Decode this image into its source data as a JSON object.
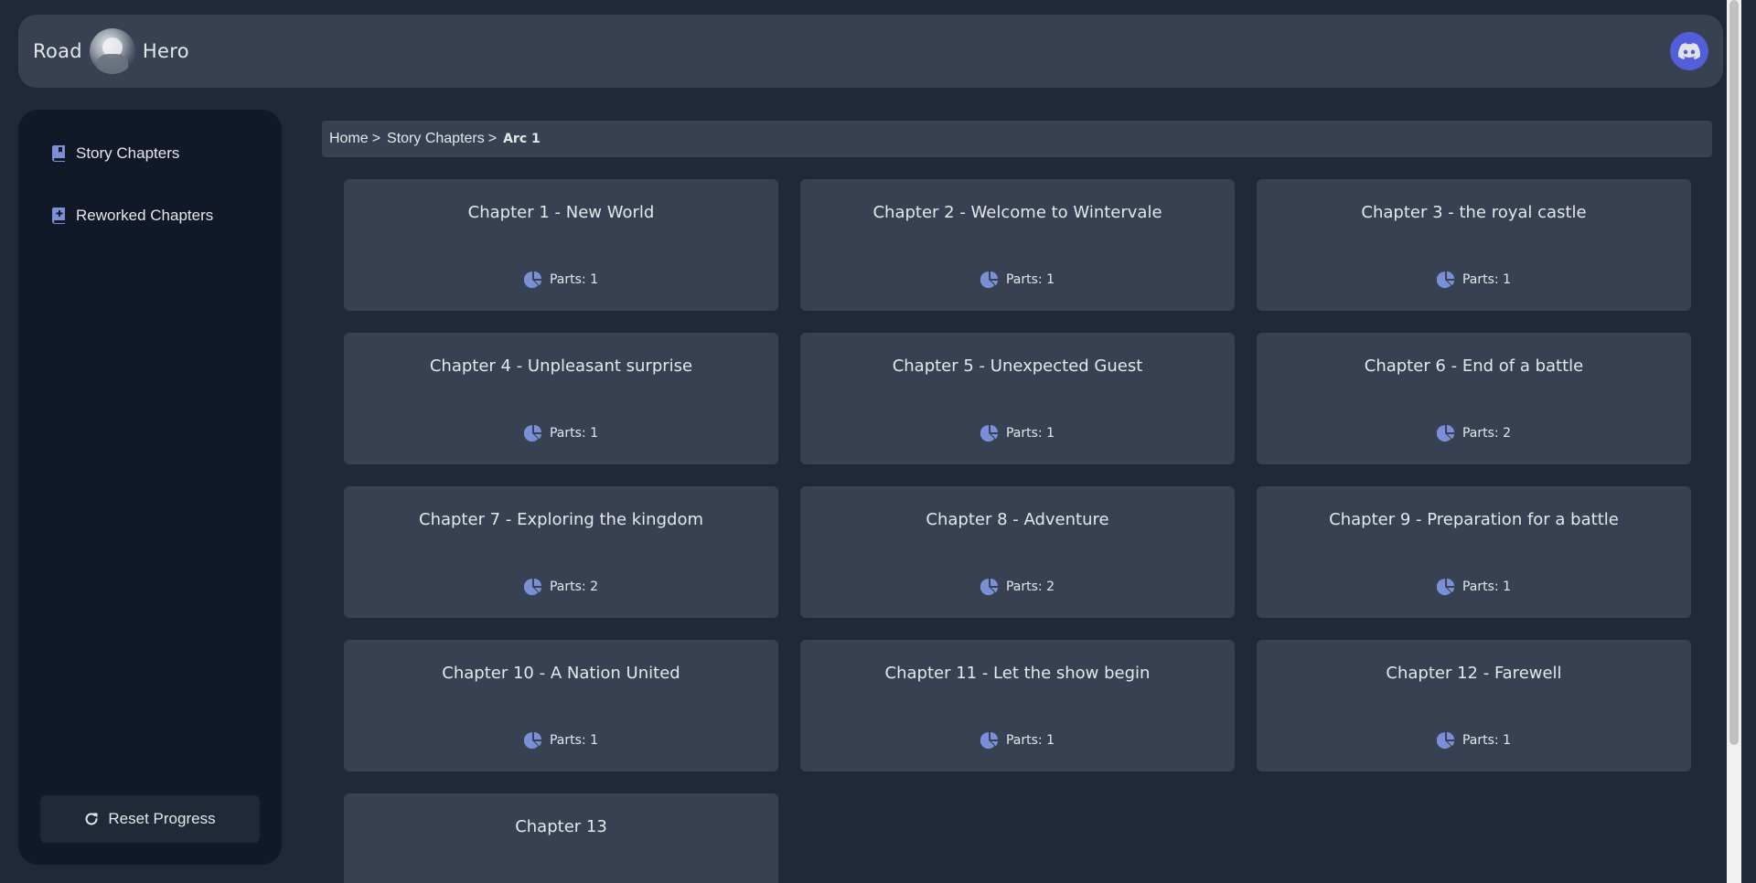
{
  "header": {
    "brand_left": "Road",
    "brand_right": "Hero",
    "discord_icon": "discord-icon"
  },
  "sidebar": {
    "items": [
      {
        "label": "Story Chapters",
        "icon": "book-icon"
      },
      {
        "label": "Reworked Chapters",
        "icon": "book-plus-icon"
      }
    ],
    "reset_label": "Reset Progress",
    "reset_icon": "refresh-icon"
  },
  "breadcrumb": {
    "home": "Home",
    "sep1": ">",
    "story": "Story Chapters",
    "sep2": ">",
    "current": "Arc 1"
  },
  "chapters": [
    {
      "title": "Chapter 1 - New World",
      "parts": "Parts: 1"
    },
    {
      "title": "Chapter 2 - Welcome to Wintervale",
      "parts": "Parts: 1"
    },
    {
      "title": "Chapter 3 - the royal castle",
      "parts": "Parts: 1"
    },
    {
      "title": "Chapter 4 - Unpleasant surprise",
      "parts": "Parts: 1"
    },
    {
      "title": "Chapter 5 - Unexpected Guest",
      "parts": "Parts: 1"
    },
    {
      "title": "Chapter 6 - End of a battle",
      "parts": "Parts: 2"
    },
    {
      "title": "Chapter 7 - Exploring the kingdom",
      "parts": "Parts: 2"
    },
    {
      "title": "Chapter 8 - Adventure",
      "parts": "Parts: 2"
    },
    {
      "title": "Chapter 9 - Preparation for a battle",
      "parts": "Parts: 1"
    },
    {
      "title": "Chapter 10 - A Nation United",
      "parts": "Parts: 1"
    },
    {
      "title": "Chapter 11 - Let the show begin",
      "parts": "Parts: 1"
    },
    {
      "title": "Chapter 12 - Farewell",
      "parts": "Parts: 1"
    },
    {
      "title": "Chapter 13",
      "parts": ""
    }
  ],
  "colors": {
    "background": "#1f2937",
    "panel": "#374151",
    "sidebar": "#111827",
    "accent": "#7b8fd8",
    "discord": "#5865f2"
  }
}
